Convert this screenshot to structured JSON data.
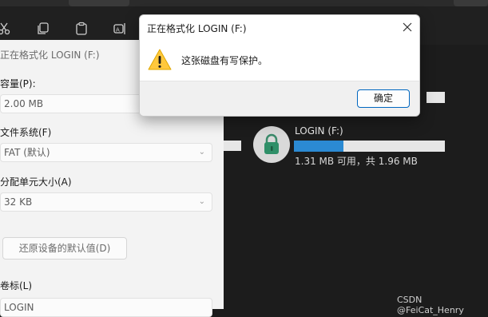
{
  "toolbar": {
    "icons": [
      "cut-icon",
      "copy-icon",
      "paste-icon",
      "rename-icon"
    ]
  },
  "format_dialog": {
    "title": "正在格式化 LOGIN (F:)",
    "capacity_label": "容量(P):",
    "capacity_value": "2.00 MB",
    "filesystem_label": "文件系统(F)",
    "filesystem_value": "FAT (默认)",
    "allocation_label": "分配单元大小(A)",
    "allocation_value": "32 KB",
    "restore_button": "还原设备的默认值(D)",
    "volume_label": "卷标(L)",
    "volume_value": "LOGIN"
  },
  "drive": {
    "name": "LOGIN (F:)",
    "usage_fraction": 0.33,
    "free_text": "1.31 MB 可用，共 1.96 MB",
    "accent_color": "#2b8ad3"
  },
  "message_box": {
    "title": "正在格式化 LOGIN (F:)",
    "message": "这张磁盘有写保护。",
    "ok_button": "确定",
    "icon": "warning-icon",
    "close_icon": "close-icon"
  },
  "watermark": "CSDN @FeiCat_Henry"
}
